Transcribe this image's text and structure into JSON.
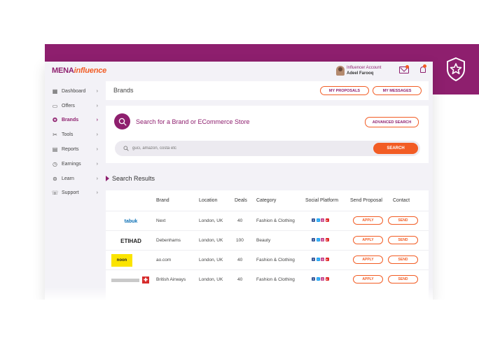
{
  "header": {
    "logo_part1": "MENA",
    "logo_part2": "influence",
    "user_role": "Influencer Account",
    "user_name": "Adeel Farooq"
  },
  "sidebar": {
    "items": [
      {
        "label": "Dashboard",
        "icon": "dashboard-icon"
      },
      {
        "label": "Offers",
        "icon": "offers-icon"
      },
      {
        "label": "Brands",
        "icon": "star-badge-icon",
        "active": true
      },
      {
        "label": "Tools",
        "icon": "tools-icon"
      },
      {
        "label": "Reports",
        "icon": "reports-icon"
      },
      {
        "label": "Earnings",
        "icon": "earnings-icon"
      },
      {
        "label": "Learn",
        "icon": "learn-icon"
      },
      {
        "label": "Support",
        "icon": "support-icon"
      }
    ]
  },
  "brands_bar": {
    "title": "Brands",
    "my_proposals": "MY PROPOSALS",
    "my_messages": "MY MESSAGES"
  },
  "search": {
    "heading": "Search for a Brand or ECommerce Store",
    "advanced": "ADVANCED SEARCH",
    "placeholder": "guci, amazon, costa etc",
    "button": "SEARCH"
  },
  "results": {
    "title": "Search Results",
    "columns": [
      "Brand",
      "Location",
      "Deals",
      "Category",
      "Social Platform",
      "Send Proposal",
      "Contact"
    ],
    "apply_label": "APPLY",
    "send_label": "SEND",
    "rows": [
      {
        "logo": "tabuk",
        "brand": "Next",
        "location": "London, UK",
        "deals": "40",
        "category": "Fashion & Clothing"
      },
      {
        "logo": "ETIHAD",
        "brand": "Debenhams",
        "location": "London, UK",
        "deals": "100",
        "category": "Beauty"
      },
      {
        "logo": "noon",
        "brand": "ao.com",
        "location": "London, UK",
        "deals": "40",
        "category": "Fashion & Clothing"
      },
      {
        "logo": "",
        "brand": "British Airways",
        "location": "London, UK",
        "deals": "40",
        "category": "Fashion & Clothing"
      }
    ]
  },
  "colors": {
    "brand_purple": "#8e1f6e",
    "accent_orange": "#f25c24",
    "background": "#f3f2f7"
  }
}
